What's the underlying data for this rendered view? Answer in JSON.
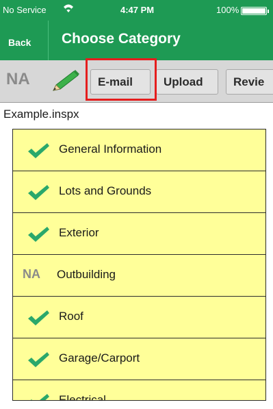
{
  "status_bar": {
    "carrier": "No Service",
    "time": "4:47 PM",
    "battery": "100%"
  },
  "nav": {
    "back_label": "Back",
    "title": "Choose Category"
  },
  "toolbar": {
    "na_label": "NA",
    "buttons": [
      {
        "label": "E-mail"
      },
      {
        "label": "Upload"
      },
      {
        "label": "Revie"
      }
    ]
  },
  "file_name": "Example.inspx",
  "categories": [
    {
      "label": "General Information",
      "status": "check"
    },
    {
      "label": "Lots and Grounds",
      "status": "check"
    },
    {
      "label": "Exterior",
      "status": "check"
    },
    {
      "label": "Outbuilding",
      "status": "NA"
    },
    {
      "label": "Roof",
      "status": "check"
    },
    {
      "label": "Garage/Carport",
      "status": "check"
    },
    {
      "label": "Electrical",
      "status": "check"
    }
  ],
  "colors": {
    "brand_green": "#1e9a54",
    "row_yellow": "#ffff99",
    "check_green": "#2aa86b",
    "highlight_red": "#e51d1d"
  }
}
